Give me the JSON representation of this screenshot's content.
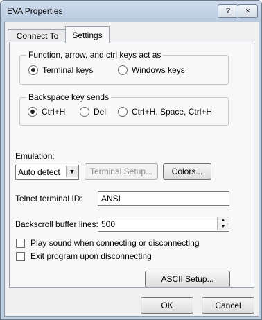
{
  "window": {
    "title": "EVA Properties",
    "help_button": "?",
    "close_button": "×"
  },
  "tabs": [
    {
      "label": "Connect To",
      "selected": false
    },
    {
      "label": "Settings",
      "selected": true
    }
  ],
  "function_keys_group": {
    "legend": "Function, arrow, and ctrl keys act as",
    "options": [
      {
        "label": "Terminal keys",
        "selected": true
      },
      {
        "label": "Windows keys",
        "selected": false
      }
    ]
  },
  "backspace_group": {
    "legend": "Backspace key sends",
    "options": [
      {
        "label": "Ctrl+H",
        "selected": true
      },
      {
        "label": "Del",
        "selected": false
      },
      {
        "label": "Ctrl+H, Space, Ctrl+H",
        "selected": false
      }
    ]
  },
  "emulation": {
    "label": "Emulation:",
    "value": "Auto detect",
    "terminal_setup_button": "Terminal Setup...",
    "colors_button": "Colors..."
  },
  "telnet_id": {
    "label": "Telnet terminal ID:",
    "value": "ANSI"
  },
  "backscroll": {
    "label": "Backscroll buffer lines:",
    "value": "500"
  },
  "checkboxes": [
    {
      "label": "Play sound when connecting or disconnecting",
      "checked": false
    },
    {
      "label": "Exit program upon disconnecting",
      "checked": false
    }
  ],
  "ascii_setup_button": "ASCII Setup...",
  "footer": {
    "ok": "OK",
    "cancel": "Cancel"
  }
}
